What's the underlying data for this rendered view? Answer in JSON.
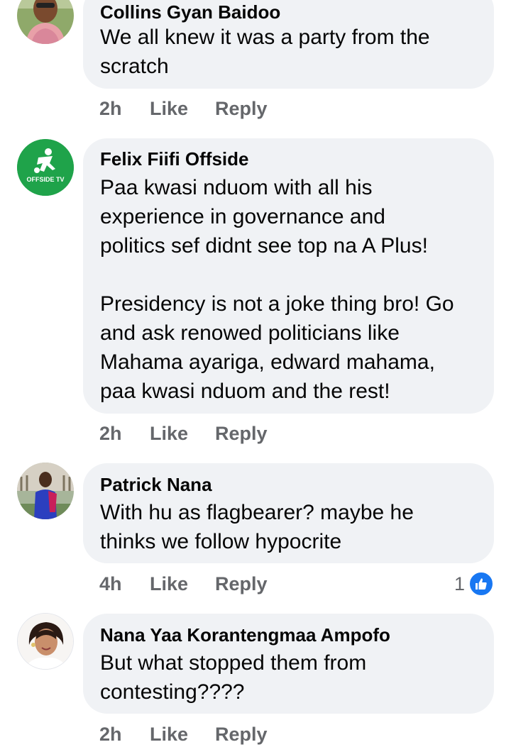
{
  "comments": [
    {
      "author": "Collins Gyan Baidoo",
      "text": "We all knew it was a party from the\nscratch",
      "time": "2h",
      "like_label": "Like",
      "reply_label": "Reply",
      "avatar_icon": "person-avatar"
    },
    {
      "author": "Felix Fiifi Offside",
      "text": "Paa kwasi nduom with all his\nexperience in governance and\npolitics sef didnt see top na A Plus!\n\nPresidency is not a joke thing bro! Go\nand ask renowed politicians like\nMahama ayariga, edward mahama,\npaa kwasi nduom and the rest!",
      "time": "2h",
      "like_label": "Like",
      "reply_label": "Reply",
      "avatar_text": "OFFSIDE TV",
      "avatar_color": "#1fa34a"
    },
    {
      "author": "Patrick Nana",
      "text": "With hu as flagbearer? maybe he\nthinks we follow hypocrite",
      "time": "4h",
      "like_label": "Like",
      "reply_label": "Reply",
      "reaction_count": "1",
      "reaction_icon": "thumbs-up-icon",
      "reaction_color": "#1877f2"
    },
    {
      "author": "Nana Yaa Korantengmaa Ampofo",
      "text": "But what stopped them from\ncontesting????",
      "time": "2h",
      "like_label": "Like",
      "reply_label": "Reply"
    }
  ]
}
